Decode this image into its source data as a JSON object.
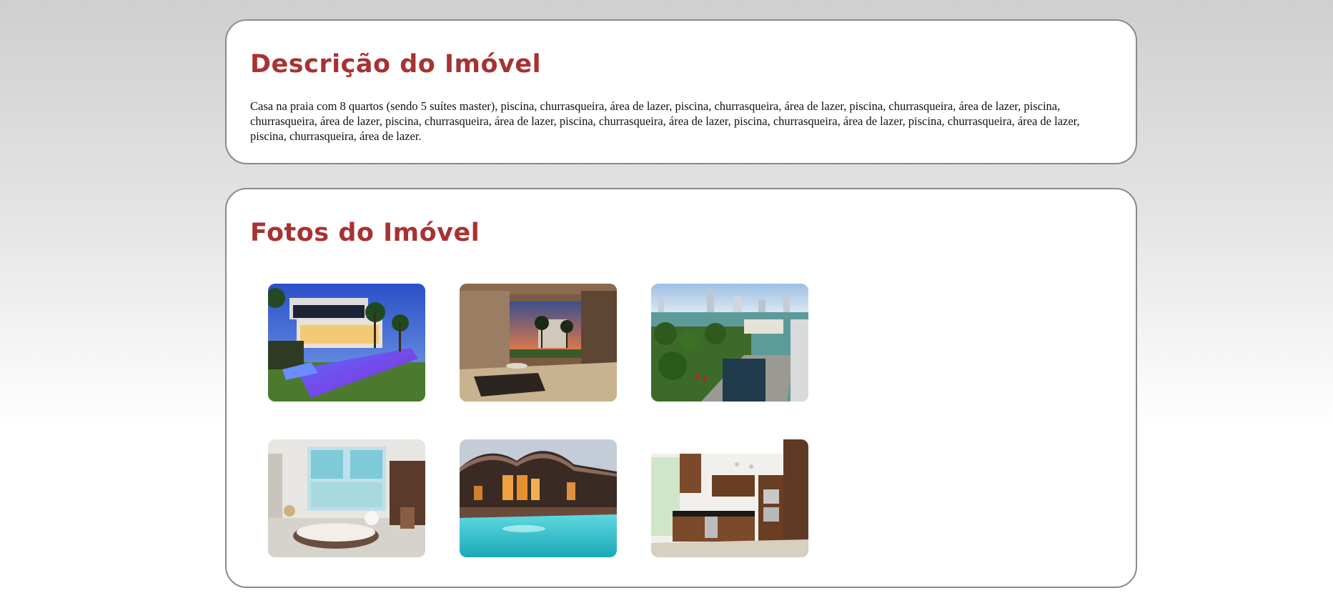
{
  "description": {
    "title": "Descrição do Imóvel",
    "text": "Casa na praia com 8 quartos (sendo 5 suítes master), piscina, churrasqueira, área de lazer, piscina, churrasqueira, área de lazer, piscina, churrasqueira, área de lazer, piscina, churrasqueira, área de lazer, piscina, churrasqueira, área de lazer, piscina, churrasqueira, área de lazer, piscina, churrasqueira, área de lazer, piscina, churrasqueira, área de lazer, piscina, churrasqueira, área de lazer."
  },
  "photos": {
    "title": "Fotos do Imóvel",
    "items": [
      {
        "subject": "modern house with illuminated pool at dusk"
      },
      {
        "subject": "open courtyard with palm trees at sunset"
      },
      {
        "subject": "aerial view of waterfront with palms and city skyline"
      },
      {
        "subject": "bright living room with white sofa"
      },
      {
        "subject": "curved-roof house with turquoise pool at night"
      },
      {
        "subject": "kitchen with wooden cabinets and stainless appliances"
      }
    ]
  },
  "colors": {
    "heading": "#a83232",
    "panel_border": "#8a8a8a"
  }
}
